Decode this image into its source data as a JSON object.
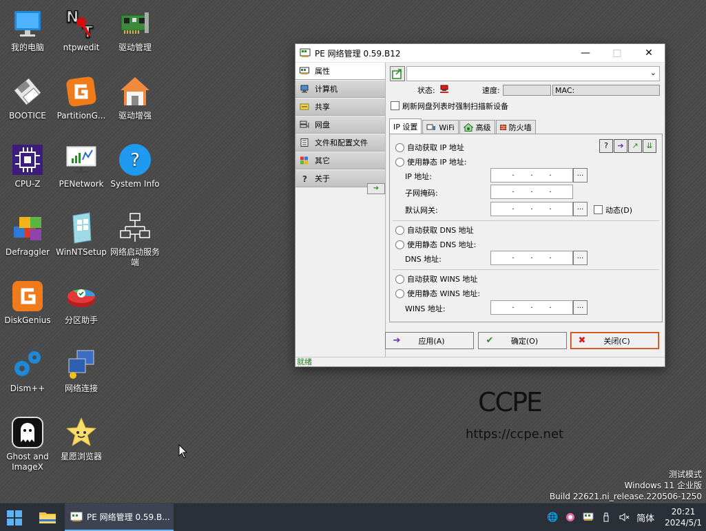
{
  "desktop": {
    "icons": [
      {
        "label": "我的电脑",
        "icon": "monitor-icon"
      },
      {
        "label": "ntpwedit",
        "icon": "key-icon"
      },
      {
        "label": "驱动管理",
        "icon": "circuit-board-icon"
      },
      {
        "label": "BOOTICE",
        "icon": "floppy-disk-icon"
      },
      {
        "label": "PartitionG...",
        "icon": "partition-guru-icon"
      },
      {
        "label": "驱动增强",
        "icon": "house-icon"
      },
      {
        "label": "CPU-Z",
        "icon": "cpu-chip-icon"
      },
      {
        "label": "PENetwork",
        "icon": "network-monitor-icon"
      },
      {
        "label": "System Info",
        "icon": "question-icon"
      },
      {
        "label": "Defraggler",
        "icon": "cubes-icon"
      },
      {
        "label": "WinNTSetup",
        "icon": "setup-tile-icon"
      },
      {
        "label": "网络启动服务端",
        "icon": "network-nodes-icon"
      },
      {
        "label": "DiskGenius",
        "icon": "diskgenius-icon"
      },
      {
        "label": "分区助手",
        "icon": "partition-pie-icon"
      },
      {
        "label": "Dism++",
        "icon": "gears-icon"
      },
      {
        "label": "网络连接",
        "icon": "network-connection-icon"
      },
      {
        "label": "Ghost and ImageX",
        "icon": "ghost-icon"
      },
      {
        "label": "星愿浏览器",
        "icon": "star-icon"
      }
    ],
    "brand": "CCPE",
    "brand_url": "https://ccpe.net",
    "watermark": [
      "测试模式",
      "Windows 11 企业版",
      "Build 22621.ni_release.220506-1250"
    ]
  },
  "window": {
    "title": "PE 网络管理 0.59.B12",
    "sidebar": [
      {
        "label": "属性",
        "icon": "network-card-icon"
      },
      {
        "label": "计算机",
        "icon": "computer-icon"
      },
      {
        "label": "共享",
        "icon": "folder-share-icon"
      },
      {
        "label": "网盘",
        "icon": "network-drive-icon"
      },
      {
        "label": "文件和配置文件",
        "icon": "file-config-icon"
      },
      {
        "label": "其它",
        "icon": "grid-icon"
      },
      {
        "label": "关于",
        "icon": "help-icon"
      }
    ],
    "adapter_combo": "",
    "status_label": "状态:",
    "speed_label": "速度:",
    "mac_label": "MAC:",
    "refresh_checkbox": "刷新网盘列表时强制扫描新设备",
    "tabs": [
      {
        "label": "IP 设置",
        "icon": ""
      },
      {
        "label": "WiFi",
        "icon": "wifi-icon"
      },
      {
        "label": "高级",
        "icon": "advanced-icon"
      },
      {
        "label": "防火墙",
        "icon": "firewall-icon"
      }
    ],
    "ip": {
      "auto_ip": "自动获取 IP 地址",
      "static_ip": "使用静态 IP 地址:",
      "ip_label": "IP 地址:",
      "mask_label": "子网掩码:",
      "gateway_label": "默认网关:",
      "dynamic_label": "动态(D)",
      "auto_dns": "自动获取 DNS 地址",
      "static_dns": "使用静态 DNS 地址:",
      "dns_label": "DNS 地址:",
      "auto_wins": "自动获取 WINS 地址",
      "static_wins": "使用静态 WINS 地址:",
      "wins_label": "WINS 地址:",
      "dots_label": "..."
    },
    "buttons": {
      "apply": "应用(A)",
      "ok": "确定(O)",
      "close": "关闭(C)"
    },
    "status": "就绪"
  },
  "taskbar": {
    "task_label": "PE 网络管理 0.59.B...",
    "ime": "简体",
    "time": "20:21",
    "date": "2024/5/1"
  },
  "colors": {
    "accent": "#66b4f5",
    "status_green": "#1a7f1a",
    "close_red": "#d62020"
  }
}
